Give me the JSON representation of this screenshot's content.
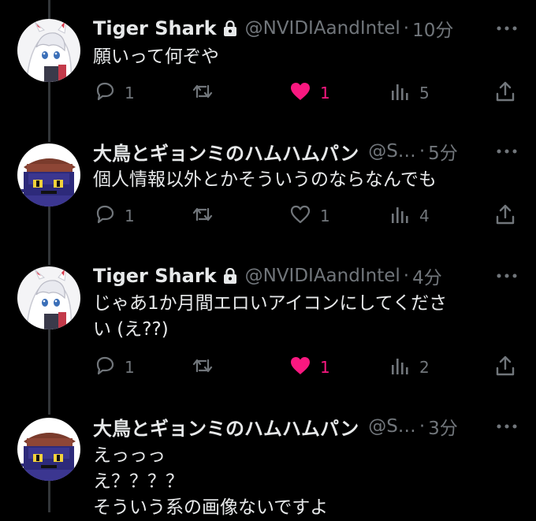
{
  "tweets": [
    {
      "name": "Tiger Shark",
      "handle": "@NVIDIAandIntel",
      "separator": "·",
      "time": "10分",
      "body": "願いって何ぞや",
      "replies": "1",
      "retweets": "",
      "likes": "1",
      "liked": true,
      "views": "5",
      "locked": true,
      "avatar": "white-hair-character-avatar"
    },
    {
      "name": "大鳥とギョンミのハムハムパン",
      "handle": "@S…",
      "separator": "·",
      "time": "5分",
      "body": "個人情報以外とかそういうのならなんでも",
      "replies": "1",
      "retweets": "",
      "likes": "1",
      "liked": false,
      "views": "4",
      "locked": false,
      "avatar": "cat-eyed-character-avatar"
    },
    {
      "name": "Tiger Shark",
      "handle": "@NVIDIAandIntel",
      "separator": "·",
      "time": "4分",
      "body": "じゃあ1か月間エロいアイコンにしてくださ\nい (え??)",
      "replies": "1",
      "retweets": "",
      "likes": "1",
      "liked": true,
      "views": "2",
      "locked": true,
      "avatar": "white-hair-character-avatar"
    },
    {
      "name": "大鳥とギョンミのハムハムパン",
      "handle": "@S…",
      "separator": "·",
      "time": "3分",
      "body": "えっっっ\nえ？？？？\nそういう系の画像ないですよ",
      "locked": false,
      "avatar": "cat-eyed-character-avatar"
    }
  ],
  "colors": {
    "background": "#000000",
    "text": "#e7e9ea",
    "secondary": "#71767b",
    "like": "#f91880",
    "thread": "#333639"
  }
}
